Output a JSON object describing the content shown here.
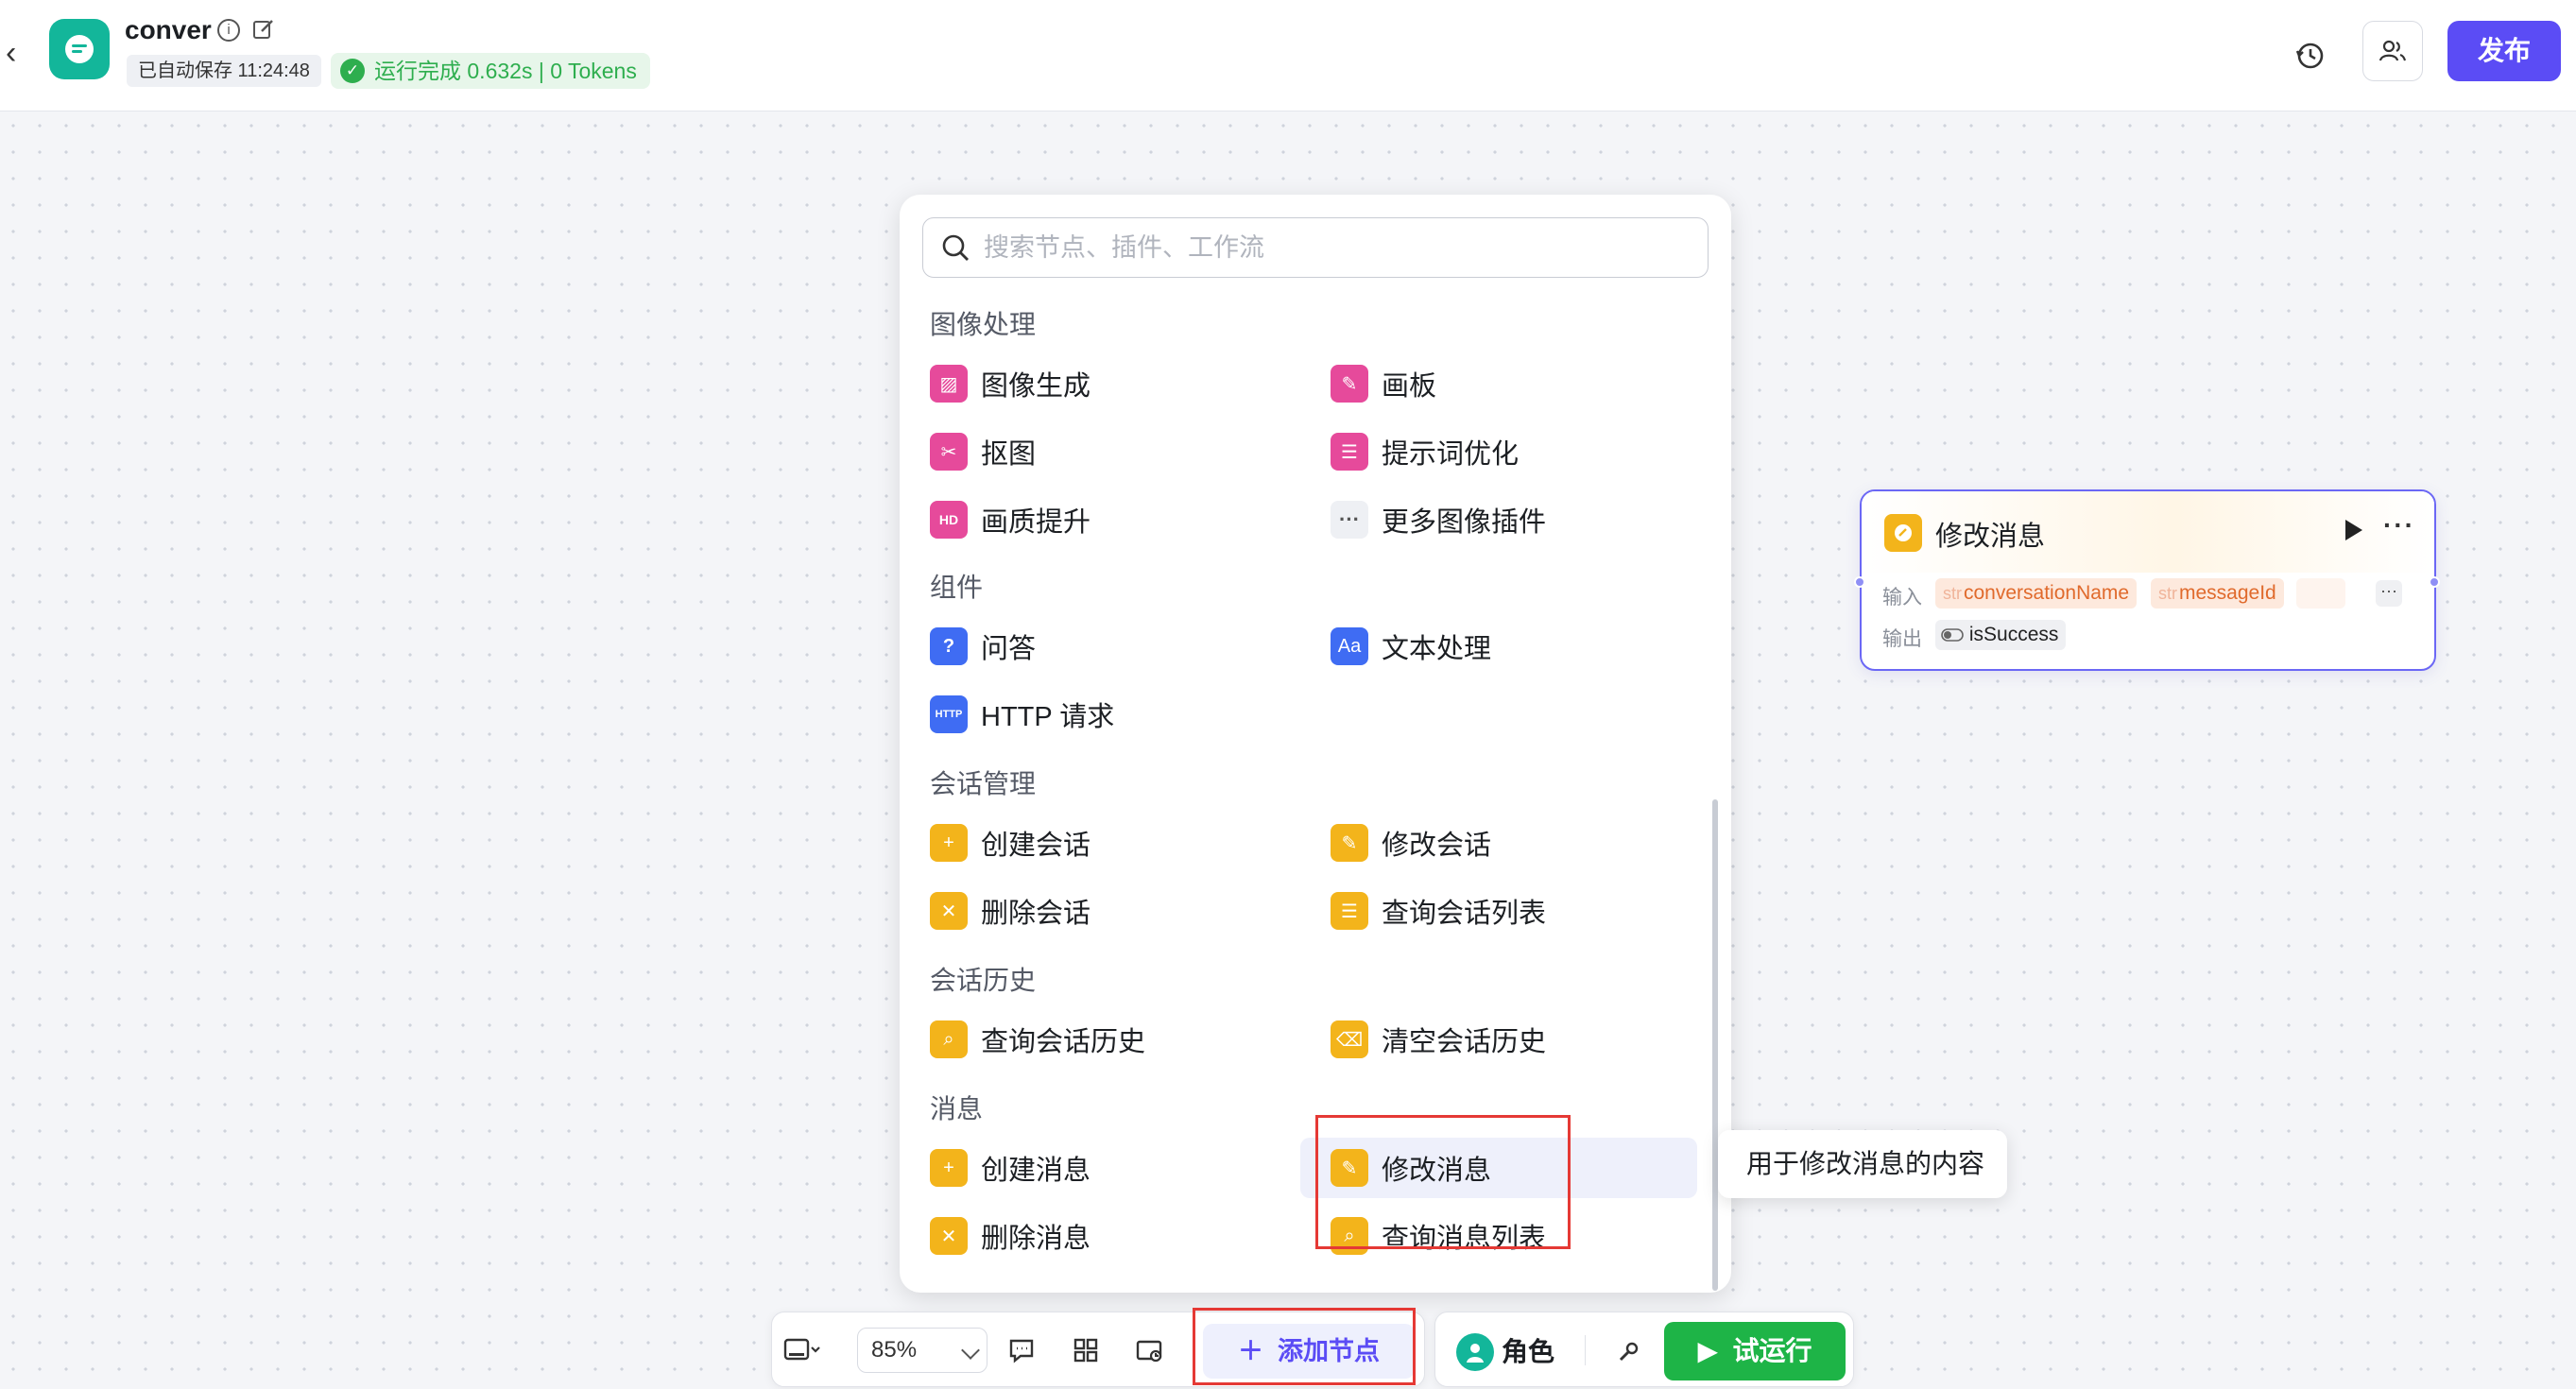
{
  "header": {
    "title": "conver",
    "saved_text": "已自动保存 11:24:48",
    "run_status": "运行完成 0.632s | 0 Tokens",
    "publish_label": "发布",
    "accent_color": "#5b4cf5"
  },
  "search": {
    "placeholder": "搜索节点、插件、工作流"
  },
  "sections": {
    "image": {
      "title": "图像处理",
      "items": [
        "图像生成",
        "画板",
        "抠图",
        "提示词优化",
        "画质提升",
        "更多图像插件"
      ]
    },
    "components": {
      "title": "组件",
      "items": [
        "问答",
        "文本处理",
        "HTTP 请求"
      ]
    },
    "conversation_mgmt": {
      "title": "会话管理",
      "items": [
        "创建会话",
        "修改会话",
        "删除会话",
        "查询会话列表"
      ]
    },
    "conversation_history": {
      "title": "会话历史",
      "items": [
        "查询会话历史",
        "清空会话历史"
      ]
    },
    "message": {
      "title": "消息",
      "items": [
        "创建消息",
        "修改消息",
        "删除消息",
        "查询消息列表"
      ]
    }
  },
  "tooltip": "用于修改消息的内容",
  "node": {
    "title": "修改消息",
    "input_label": "输入",
    "output_label": "输出",
    "str_tag": "str",
    "inputs": [
      "conversationName",
      "messageId"
    ],
    "output": "isSuccess"
  },
  "toolbar": {
    "zoom": "85%",
    "add_node_label": "添加节点",
    "role_label": "角色",
    "run_label": "试运行"
  },
  "icons": {
    "back": "chevron-left-icon",
    "info": "info-icon",
    "edit": "edit-icon",
    "history": "history-icon",
    "collaborators": "users-icon",
    "search": "search-icon",
    "more": "ellipsis-icon"
  },
  "colors": {
    "success": "#1eb447",
    "node_border": "#6b67f5",
    "icon_pink": "#e64a9b",
    "icon_blue": "#3f6cf3",
    "icon_yellow": "#f3b41b",
    "highlight_box": "#e53935"
  }
}
